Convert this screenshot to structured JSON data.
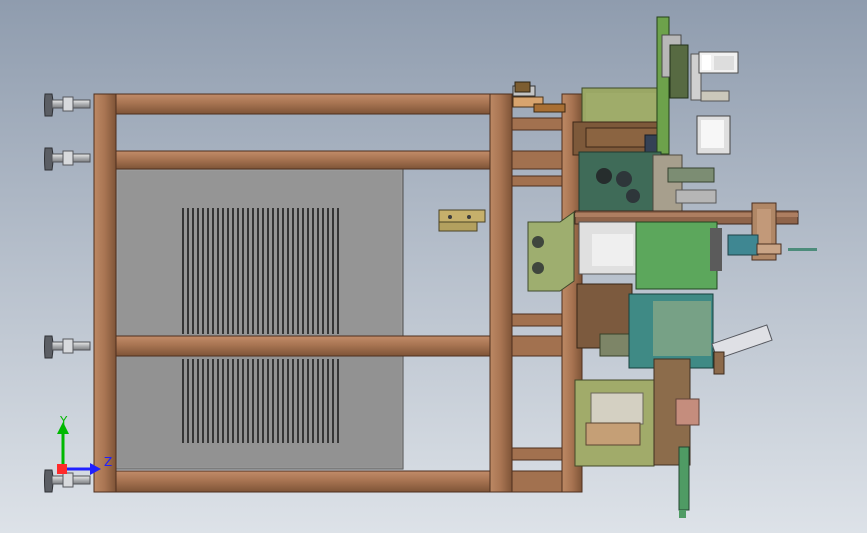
{
  "colors": {
    "frame": "#a87452",
    "frame_edge": "#4e2f1e",
    "panel_light": "#9d9d9d",
    "panel_mid": "#878787",
    "slot_dark": "#353535",
    "module_green": "#5fa35f",
    "module_olive": "#98a564",
    "module_teal": "#4c8f8c",
    "steel": "#cfcfcf",
    "axis_x": "#ff2a2a",
    "axis_y": "#00b800",
    "axis_z": "#2020ff"
  },
  "triad": {
    "y_label": "Y",
    "z_label": "Z"
  }
}
